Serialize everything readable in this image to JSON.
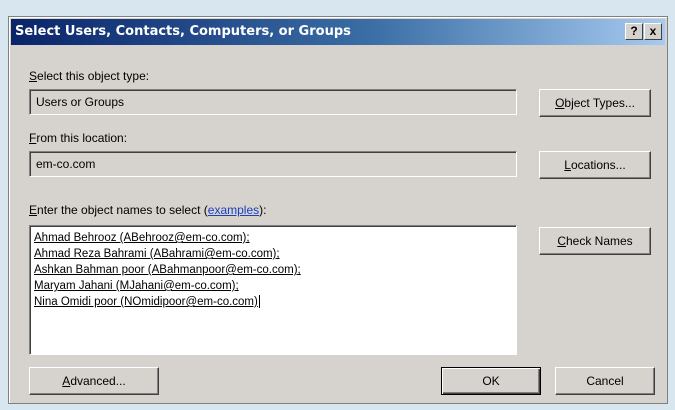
{
  "window": {
    "title": "Select Users, Contacts, Computers, or Groups",
    "help_label": "?",
    "close_label": "x"
  },
  "object_type": {
    "label_accel": "S",
    "label_rest": "elect this object type:",
    "value": "Users or Groups",
    "button_accel": "O",
    "button_rest": "bject Types..."
  },
  "location": {
    "label_accel": "F",
    "label_rest": "rom this location:",
    "value": "em-co.com",
    "button_accel": "L",
    "button_rest": "ocations..."
  },
  "names": {
    "label_accel": "E",
    "label_rest": "nter the object names to select (",
    "examples_link": "examples",
    "label_end": "):",
    "entries": [
      "Ahmad Behrooz (ABehrooz@em-co.com);",
      "Ahmad Reza Bahrami (ABahrami@em-co.com);",
      "Ashkan Bahman poor (ABahmanpoor@em-co.com);",
      "Maryam Jahani (MJahani@em-co.com);",
      "Nina Omidi poor (NOmidipoor@em-co.com)"
    ],
    "check_button_accel": "C",
    "check_button_rest": "heck Names"
  },
  "footer": {
    "advanced_accel": "A",
    "advanced_rest": "dvanced...",
    "ok_label": "OK",
    "cancel_label": "Cancel"
  },
  "colors": {
    "titlebar_start": "#0a246a",
    "titlebar_end": "#a6caf0",
    "dialog_face": "#d6d3ce",
    "link": "#1a3fc0"
  }
}
